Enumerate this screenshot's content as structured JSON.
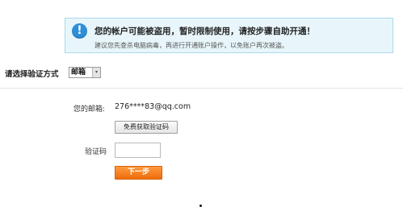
{
  "notice": {
    "icon": "info-icon",
    "icon_glyph": "!",
    "title": "您的帐户可能被盗用，暂时限制使用，请按步骤自助开通！",
    "subtitle": "建议您先查杀电脑病毒，再进行开通账户操作，以免账户再次被盗。"
  },
  "verify": {
    "label": "请选择验证方式",
    "method_selected": "邮箱",
    "arrow": "▾"
  },
  "form": {
    "email_label": "您的邮箱:",
    "email_value": "276****83@qq.com",
    "get_code_button": "免费获取验证码",
    "code_label": "验证码",
    "code_value": "",
    "next_button": "下一步"
  },
  "colors": {
    "notice_bg": "#e8f6fb",
    "notice_border": "#a9d9ea",
    "info_icon": "#2f8ed9",
    "next_button": "#f27a1a"
  }
}
